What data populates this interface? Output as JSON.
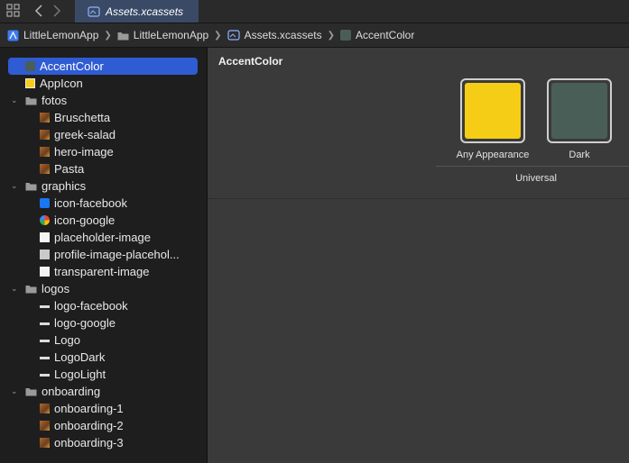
{
  "tabbar": {
    "active_tab": "Assets.xcassets"
  },
  "breadcrumb": [
    "LittleLemonApp",
    "LittleLemonApp",
    "Assets.xcassets",
    "AccentColor"
  ],
  "sidebar": {
    "selected": "AccentColor",
    "items": [
      {
        "label": "AccentColor",
        "kind": "color"
      },
      {
        "label": "AppIcon",
        "kind": "appicon"
      },
      {
        "label": "fotos",
        "kind": "folder"
      },
      {
        "label": "Bruschetta",
        "kind": "photo"
      },
      {
        "label": "greek-salad",
        "kind": "photo"
      },
      {
        "label": "hero-image",
        "kind": "photo"
      },
      {
        "label": "Pasta",
        "kind": "photo"
      },
      {
        "label": "graphics",
        "kind": "folder"
      },
      {
        "label": "icon-facebook",
        "kind": "facebook"
      },
      {
        "label": "icon-google",
        "kind": "google"
      },
      {
        "label": "placeholder-image",
        "kind": "white"
      },
      {
        "label": "profile-image-placehol...",
        "kind": "profile"
      },
      {
        "label": "transparent-image",
        "kind": "white"
      },
      {
        "label": "logos",
        "kind": "folder"
      },
      {
        "label": "logo-facebook",
        "kind": "logo"
      },
      {
        "label": "logo-google",
        "kind": "logo"
      },
      {
        "label": "Logo",
        "kind": "logo"
      },
      {
        "label": "LogoDark",
        "kind": "logo"
      },
      {
        "label": "LogoLight",
        "kind": "logo"
      },
      {
        "label": "onboarding",
        "kind": "folder"
      },
      {
        "label": "onboarding-1",
        "kind": "photo"
      },
      {
        "label": "onboarding-2",
        "kind": "photo"
      },
      {
        "label": "onboarding-3",
        "kind": "photo"
      }
    ]
  },
  "editor": {
    "title": "AccentColor",
    "swatches": [
      {
        "label": "Any Appearance",
        "color": "#f6cd16"
      },
      {
        "label": "Dark",
        "color": "#495e57"
      }
    ],
    "group_label": "Universal"
  },
  "colors": {
    "accent_swatch_sidebar": "#495e57",
    "selection": "#2f5bd3",
    "tab_active": "#3a4a66"
  }
}
